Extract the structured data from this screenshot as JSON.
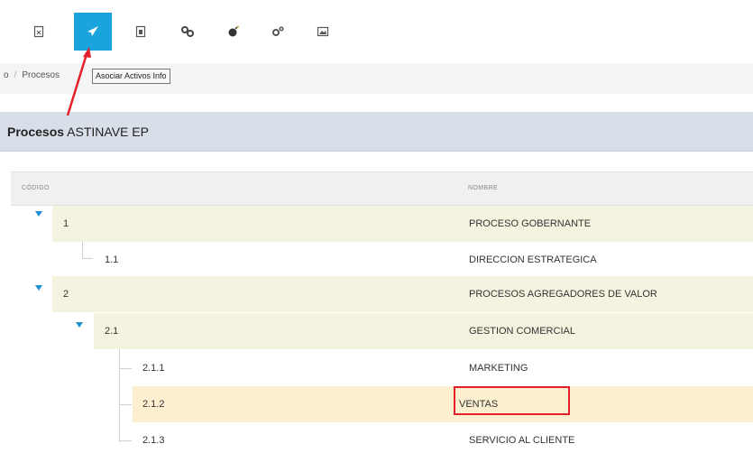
{
  "toolbar": {
    "buttons": [
      {
        "icon": "document-icon"
      },
      {
        "icon": "paper-plane-icon",
        "active": true
      },
      {
        "icon": "file-icon"
      },
      {
        "icon": "link-icon"
      },
      {
        "icon": "bomb-icon"
      },
      {
        "icon": "gears-icon"
      },
      {
        "icon": "image-icon"
      }
    ],
    "active_color": "#1aa3dc"
  },
  "breadcrumb": {
    "items": [
      "o",
      "Procesos"
    ],
    "separator": "/"
  },
  "tooltip": {
    "text": "Asociar Activos Info"
  },
  "panel": {
    "title_bold": "Procesos",
    "title_rest": " ASTINAVE EP"
  },
  "table": {
    "columns": {
      "code": "CÓDIGO",
      "name": "NOMBRE"
    },
    "rows": [
      {
        "code": "1",
        "name": "PROCESO GOBERNANTE",
        "level": 0,
        "expanded": true
      },
      {
        "code": "1.1",
        "name": "DIRECCION ESTRATEGICA",
        "level": 1
      },
      {
        "code": "2",
        "name": "PROCESOS AGREGADORES DE VALOR",
        "level": 0,
        "expanded": true
      },
      {
        "code": "2.1",
        "name": "GESTION COMERCIAL",
        "level": 1,
        "expanded": true
      },
      {
        "code": "2.1.1",
        "name": "MARKETING",
        "level": 2
      },
      {
        "code": "2.1.2",
        "name": "VENTAS",
        "level": 2,
        "selected": true
      },
      {
        "code": "2.1.3",
        "name": "SERVICIO AL CLIENTE",
        "level": 2
      }
    ]
  },
  "colors": {
    "parent_row_bg": "#f3f3df",
    "selected_row_bg": "#fbefcf",
    "header_bg": "#d8dfe8",
    "annotation_red": "#e3202a"
  }
}
